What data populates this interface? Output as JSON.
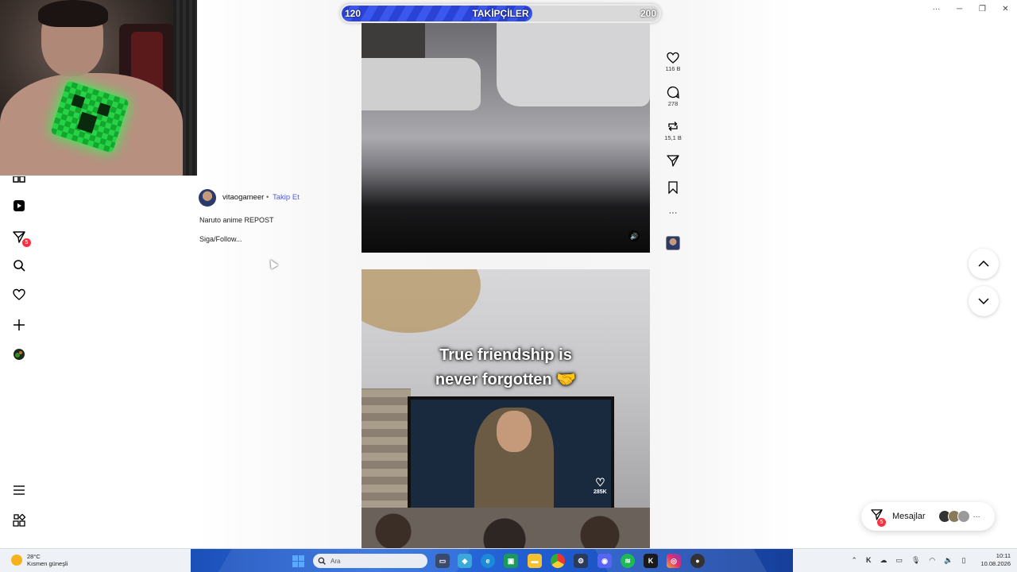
{
  "window_controls": {
    "more": "···",
    "minimize": "─",
    "restore": "❐",
    "close": "✕"
  },
  "followers_bar": {
    "current": "120",
    "label": "TAKİPÇİLER",
    "target": "200",
    "progress_fraction": 0.6
  },
  "nav": {
    "notifications_badge": "5"
  },
  "post": {
    "username": "vitaogameer",
    "separator": "•",
    "follow_label": "Takip Et",
    "caption_line1": "Naruto anime REPOST",
    "caption_line2": "Siga/Follow..."
  },
  "actions": {
    "likes": "116 B",
    "comments": "278",
    "reposts": "15,1 B",
    "more": "···"
  },
  "video2": {
    "text_line1": "True friendship is",
    "text_line2": "never forgotten 🤝",
    "inner_likes": "285K"
  },
  "messages": {
    "label": "Mesajlar",
    "badge": "5",
    "more": "···"
  },
  "taskbar": {
    "weather_temp": "28°C",
    "weather_desc": "Kısmen güneşli",
    "search_placeholder": "Ara",
    "time": "10:11",
    "date": "10.08.2026"
  },
  "colors": {
    "accent": "#4a5be0",
    "bar_fill": "#2a43d6",
    "badge": "#ff3040"
  }
}
